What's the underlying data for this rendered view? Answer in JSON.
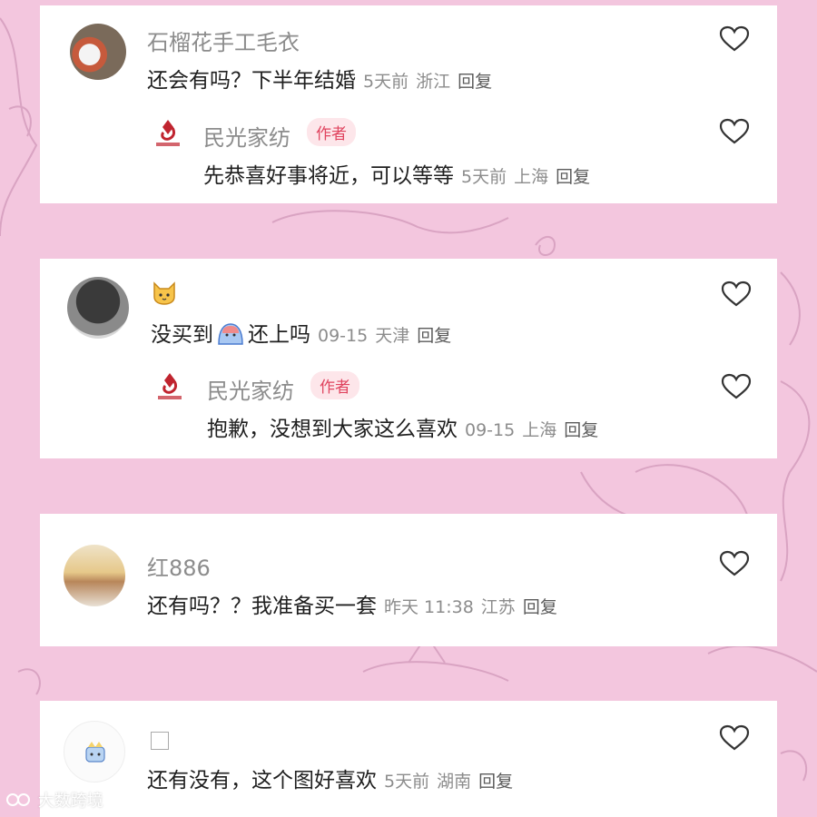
{
  "comments": [
    {
      "user": "石榴花手工毛衣",
      "text": "还会有吗？下半年结婚",
      "time": "5天前",
      "location": "浙江",
      "reply": "回复",
      "author_reply": {
        "user": "民光家纺",
        "badge": "作者",
        "text": "先恭喜好事将近，可以等等",
        "time": "5天前",
        "location": "上海",
        "reply": "回复"
      }
    },
    {
      "user_emoji": "cat-face-icon",
      "text_before": "没买到",
      "text_after": "还上吗",
      "time": "09-15",
      "location": "天津",
      "reply": "回复",
      "author_reply": {
        "user": "民光家纺",
        "badge": "作者",
        "text": "抱歉，没想到大家这么喜欢",
        "time": "09-15",
        "location": "上海",
        "reply": "回复"
      }
    },
    {
      "user": "红886",
      "text": "还有吗？？我准备买一套",
      "time": "昨天 11:38",
      "location": "江苏",
      "reply": "回复"
    },
    {
      "text": "还有没有，这个图好喜欢",
      "time": "5天前",
      "location": "湖南",
      "reply": "回复"
    }
  ],
  "watermark": "大数跨境",
  "colors": {
    "background": "#f3c6de",
    "card": "#ffffff",
    "badge_text": "#e0445f",
    "badge_bg": "#fde6ea",
    "brand_red": "#c0242f"
  }
}
